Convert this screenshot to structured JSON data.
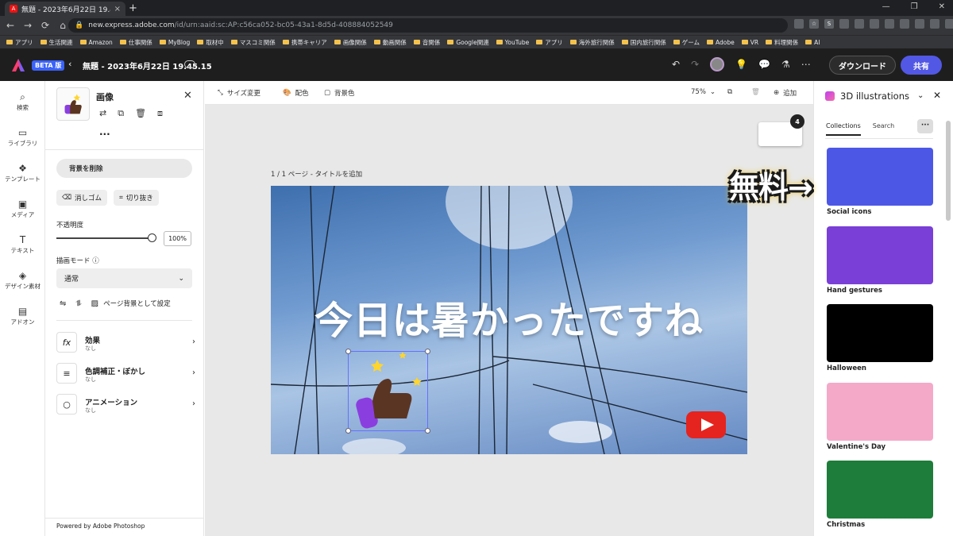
{
  "browser": {
    "tab_title": "無題 - 2023年6月22日 19.45.15",
    "url_host": "new.express.adobe.com",
    "url_path": "/id/urn:aaid:sc:AP:c56ca052-bc05-43a1-8d5d-408884052549",
    "bookmarks": [
      "アプリ",
      "生活関連",
      "Amazon",
      "仕事関係",
      "MyBlog",
      "取材中",
      "マスコミ関係",
      "携帯キャリア",
      "画像関係",
      "動画関係",
      "音関係",
      "Google関連",
      "YouTube",
      "アプリ",
      "海外旅行関係",
      "国内旅行関係",
      "ゲーム",
      "Adobe",
      "VR",
      "料理関係",
      "AI"
    ]
  },
  "header": {
    "beta_label": "BETA 版",
    "doc_title": "無題 - 2023年6月22日 19.45.15",
    "download_label": "ダウンロード",
    "share_label": "共有"
  },
  "rail": {
    "items": [
      {
        "label": "検索",
        "icon": "search-icon"
      },
      {
        "label": "ライブラリ",
        "icon": "folder-icon"
      },
      {
        "label": "テンプレート",
        "icon": "template-icon"
      },
      {
        "label": "メディア",
        "icon": "media-icon"
      },
      {
        "label": "テキスト",
        "icon": "text-icon"
      },
      {
        "label": "デザイン素材",
        "icon": "shapes-icon"
      },
      {
        "label": "アドオン",
        "icon": "addon-icon"
      }
    ]
  },
  "props": {
    "title": "画像",
    "remove_bg": "背景を削除",
    "eraser": "消しゴム",
    "crop": "切り抜き",
    "opacity_label": "不透明度",
    "opacity_value": "100%",
    "opacity_level": 1.0,
    "blend_label": "描画モード",
    "blend_value": "通常",
    "set_bg": "ページ背景として設定",
    "rows": [
      {
        "title": "効果",
        "sub": "なし",
        "icon": "fx"
      },
      {
        "title": "色調補正・ぼかし",
        "sub": "なし",
        "icon": "≡"
      },
      {
        "title": "アニメーション",
        "sub": "なし",
        "icon": "○"
      }
    ],
    "powered": "Powered by Adobe Photoshop"
  },
  "toolbar": {
    "resize": "サイズ変更",
    "color": "配色",
    "bgcolor": "背景色",
    "zoom": "75%",
    "add": "追加"
  },
  "canvas": {
    "page_badge": "4",
    "page_label": "1 / 1 ページ - タイトルを追加",
    "headline": "今日は暑かったですね"
  },
  "right_panel": {
    "title": "3D illustrations",
    "tab_collections": "Collections",
    "tab_search": "Search",
    "cards": [
      {
        "label": "Social icons",
        "color": "#4d57e6"
      },
      {
        "label": "Hand gestures",
        "color": "#7a3fd6"
      },
      {
        "label": "Halloween",
        "color": "#000000"
      },
      {
        "label": "Valentine's Day",
        "color": "#f4a9c8"
      },
      {
        "label": "Christmas",
        "color": "#1e7d3a"
      }
    ]
  },
  "annotation": {
    "text": "無料→"
  }
}
